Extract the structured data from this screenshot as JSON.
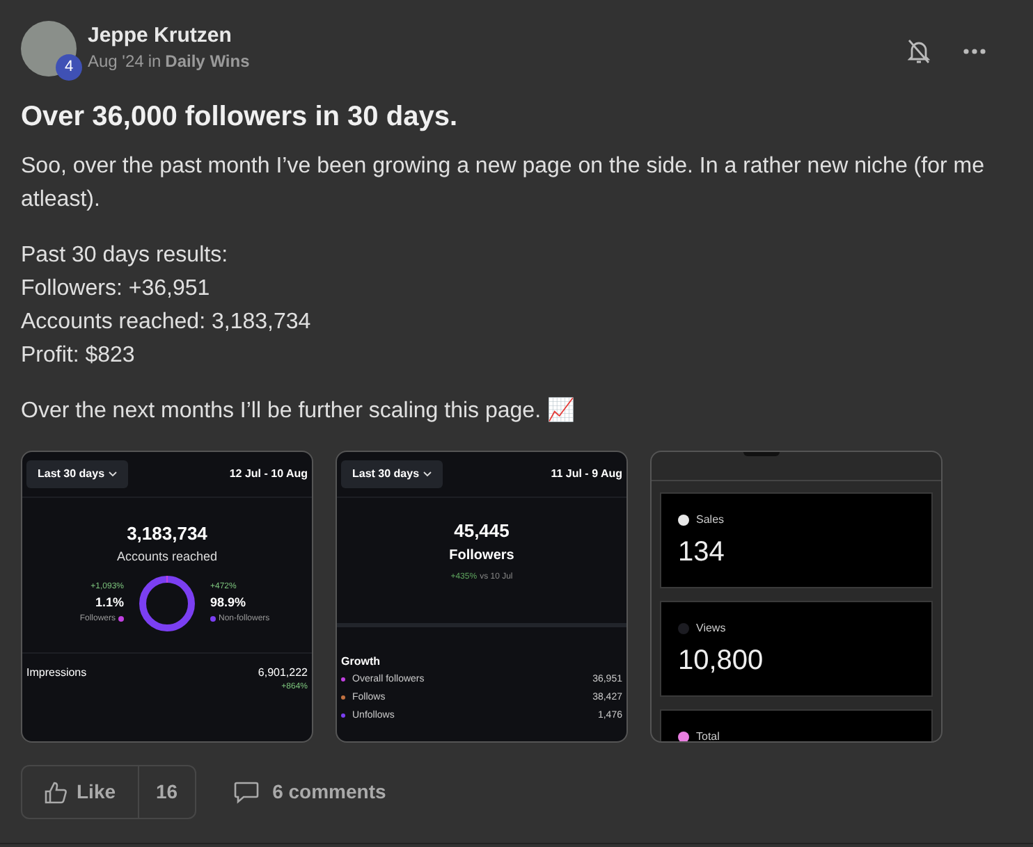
{
  "post": {
    "author": "Jeppe Krutzen",
    "level_badge": "4",
    "date": "Aug '24",
    "in_label": "in",
    "category": "Daily Wins",
    "title": "Over 36,000 followers in 30 days.",
    "paragraphs": [
      [
        "Soo, over the past month I’ve been growing a new page on the side. In a rather new niche (for me atleast)."
      ],
      [
        "Past 30 days results:",
        "Followers: +36,951",
        "Accounts reached: 3,183,734",
        "Profit: $823"
      ],
      [
        "Over the next months I’ll be further scaling this page. 📈"
      ]
    ]
  },
  "reach_card": {
    "range_button": "Last 30 days",
    "dates": "12 Jul - 10 Aug",
    "total": "3,183,734",
    "total_label": "Accounts reached",
    "left": {
      "change": "+1,093%",
      "share": "1.1%",
      "label": "Followers",
      "color": "#c040e0"
    },
    "right": {
      "change": "+472%",
      "share": "98.9%",
      "label": "Non-followers",
      "color": "#7b3ff2"
    },
    "impressions_label": "Impressions",
    "impressions_value": "6,901,222",
    "impressions_change": "+864%"
  },
  "followers_card": {
    "range_button": "Last 30 days",
    "dates": "11 Jul - 9 Aug",
    "total": "45,445",
    "total_label": "Followers",
    "change": "+435%",
    "change_suffix": "vs 10 Jul",
    "growth_title": "Growth",
    "growth": [
      {
        "label": "Overall followers",
        "value": "36,951",
        "color": "#c040e0"
      },
      {
        "label": "Follows",
        "value": "38,427",
        "color": "#c07040"
      },
      {
        "label": "Unfollows",
        "value": "1,476",
        "color": "#7b3ff2"
      }
    ]
  },
  "sales_card": {
    "tiles": [
      {
        "label": "Sales",
        "value": "134",
        "color": "#e8e8e8"
      },
      {
        "label": "Views",
        "value": "10,800",
        "color": "#1c1c22"
      },
      {
        "label": "Total",
        "color": "#e87ee0"
      }
    ]
  },
  "actions": {
    "like": "Like",
    "like_count": "16",
    "comments": "6 comments"
  }
}
